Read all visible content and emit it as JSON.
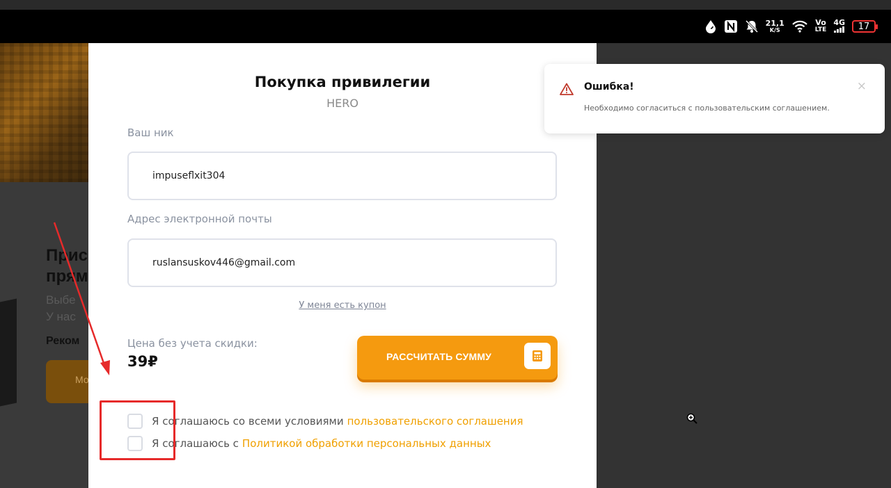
{
  "status_bar": {
    "net_speed_value": "21,1",
    "net_speed_unit": "K/S",
    "volte_top": "Vo",
    "volte_bottom": "LTE",
    "network_type": "4G",
    "battery_level": "17"
  },
  "background_page": {
    "heading_line1": "Прис",
    "heading_line2": "прям",
    "text_line1": "Выбе",
    "text_line2": "У нас",
    "recommended": "Реком",
    "button_label": "Мо"
  },
  "modal": {
    "title": "Покупка привилегии",
    "subtitle": "HERO",
    "nick_label": "Ваш ник",
    "nick_value": "impuseflxit304",
    "email_label": "Адрес электронной почты",
    "email_value": "ruslansuskov446@gmail.com",
    "coupon_link": "У меня есть купон",
    "price_label": "Цена без учета скидки:",
    "price_value": "39₽",
    "calc_button_label": "РАССЧИТАТЬ СУММУ",
    "agreement_text": "Я соглашаюсь со всеми условиями",
    "agreement_link": "пользовательского соглашения",
    "privacy_text": "Я соглашаюсь с",
    "privacy_link": "Политикой обработки персональных данных"
  },
  "toast": {
    "title": "Ошибка!",
    "message": "Необходимо согласиться с пользовательским соглашением.",
    "close_symbol": "×"
  },
  "colors": {
    "accent": "#f59a0f",
    "link": "#f0a000",
    "annotation": "#e62a2a",
    "error_icon": "#c0392b"
  }
}
